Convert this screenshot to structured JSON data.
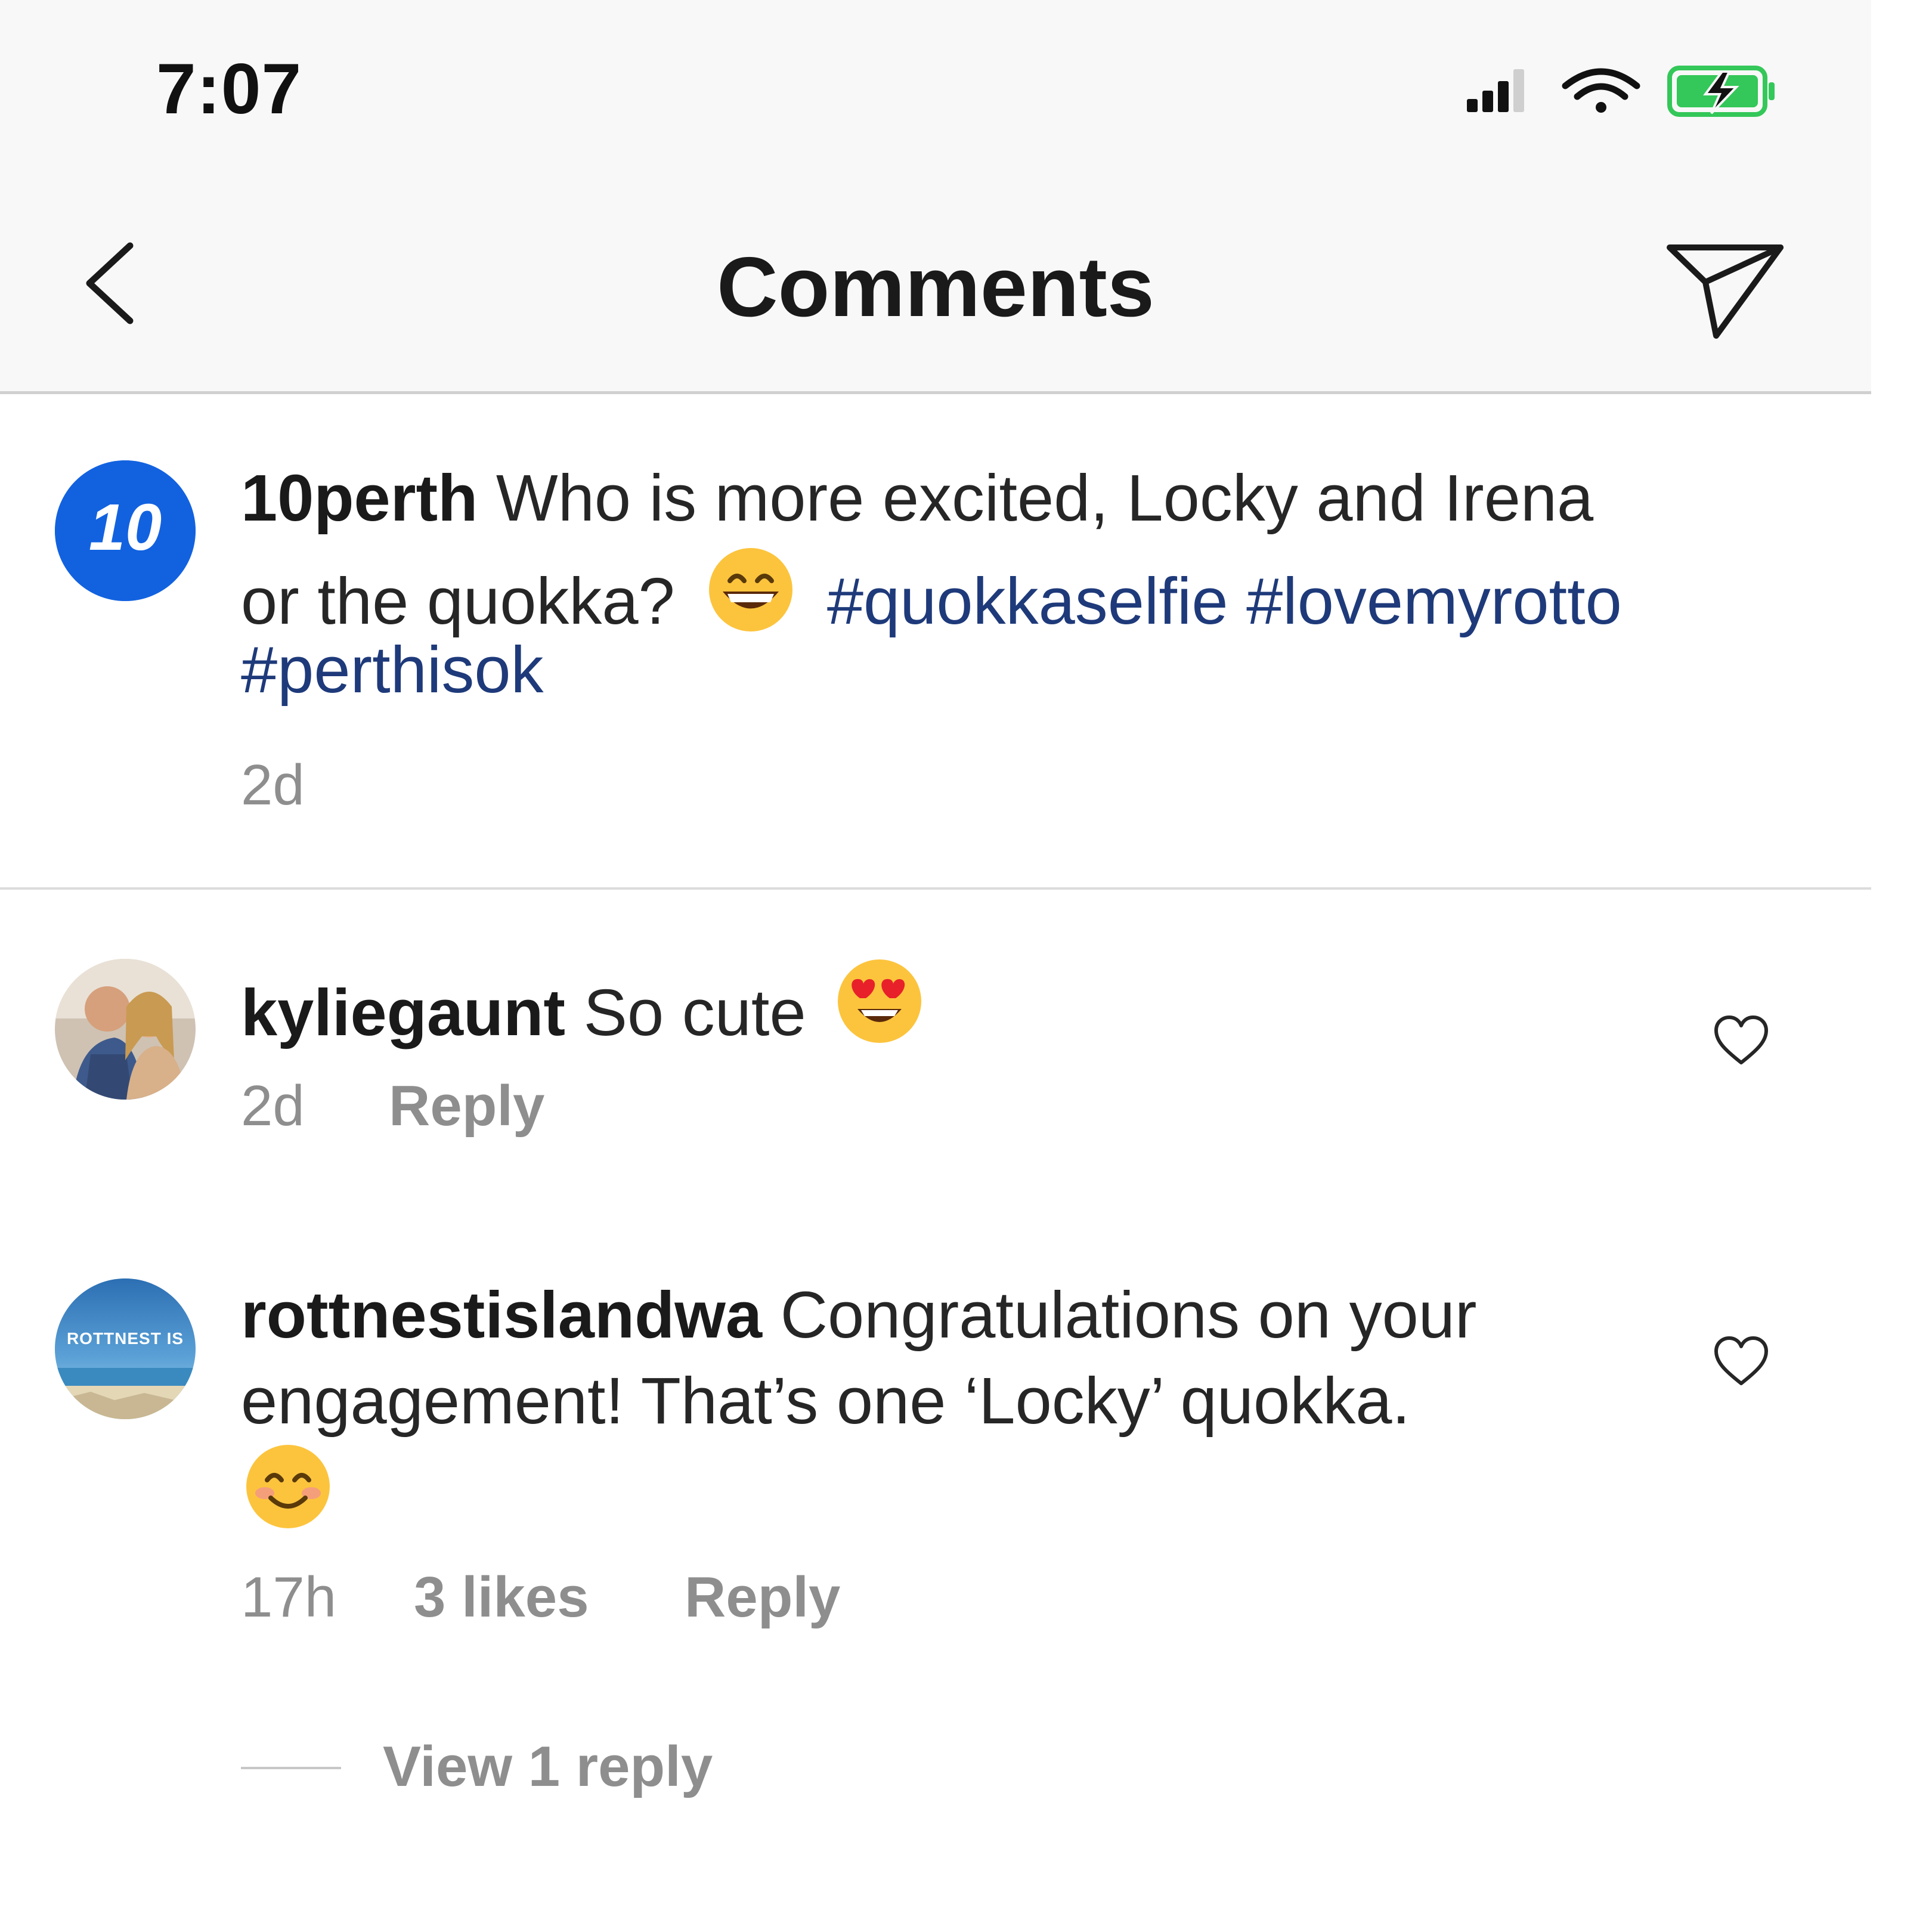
{
  "status_bar": {
    "time": "7:07"
  },
  "header": {
    "title": "Comments"
  },
  "caption": {
    "username": "10perth",
    "line1_text": "Who is more excited, Locky and Irena",
    "line2_text": "or the quokka?",
    "hashtags_line2": "#quokkaselfie #lovemyrotto",
    "hashtags_line3": "#perthisok",
    "time": "2d",
    "avatar_label": "10"
  },
  "comments": [
    {
      "username": "kyliegaunt",
      "text": "So cute",
      "time": "2d",
      "reply_label": "Reply"
    },
    {
      "username": "rottnestislandwa",
      "line1_text": "Congratulations on your",
      "line2_text": "engagement! That’s one ‘Locky’ quokka.",
      "time": "17h",
      "likes": "3 likes",
      "reply_label": "Reply",
      "avatar_label": "ROTTNEST IS",
      "view_replies": "View 1 reply"
    }
  ],
  "colors": {
    "hashtag": "#1e3a7a",
    "meta_grey": "#8e8e8e",
    "battery_green": "#34c759",
    "brand_blue": "#1262e0"
  },
  "icons": {
    "back": "chevron-left-icon",
    "send": "paper-plane-icon",
    "like": "heart-outline-icon"
  }
}
